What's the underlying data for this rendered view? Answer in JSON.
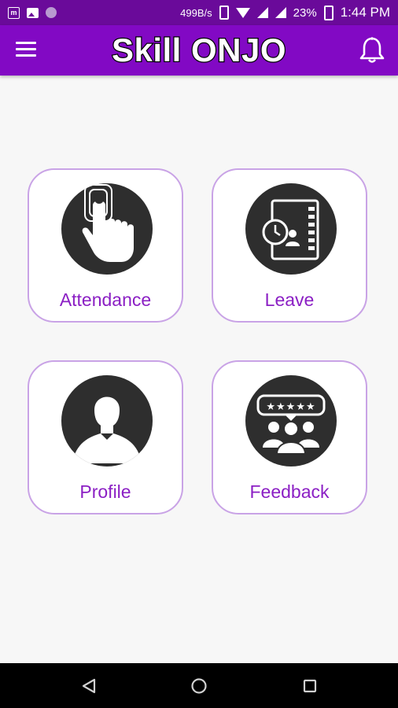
{
  "status_bar": {
    "speed": "499B/s",
    "battery": "23%",
    "time": "1:44 PM"
  },
  "app_bar": {
    "title": "Skill ONJO"
  },
  "cards": [
    {
      "label": "Attendance",
      "icon": "fingerprint-touch-icon"
    },
    {
      "label": "Leave",
      "icon": "leave-calendar-icon"
    },
    {
      "label": "Profile",
      "icon": "profile-person-icon"
    },
    {
      "label": "Feedback",
      "icon": "feedback-rating-icon"
    }
  ],
  "colors": {
    "primary": "#8209c4",
    "status_bar": "#6a0a9a",
    "card_border": "#c9a3e6",
    "label": "#8b1fc4",
    "icon_bg": "#2e2e2e"
  }
}
